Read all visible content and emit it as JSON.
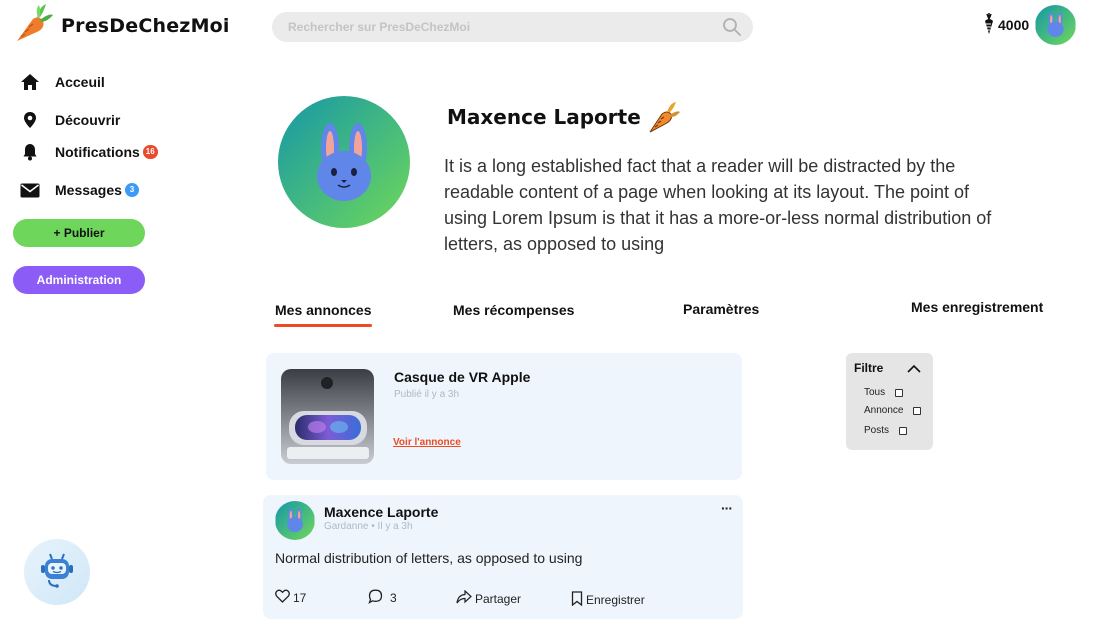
{
  "brand": {
    "name": "PresDeChezMoi",
    "accent": "#ef4b23"
  },
  "search": {
    "placeholder": "Rechercher sur PresDeChezMoi",
    "value": ""
  },
  "header": {
    "coins": "4000"
  },
  "sidebar": {
    "items": [
      {
        "label": "Acceuil",
        "icon": "home-icon"
      },
      {
        "label": "Découvrir",
        "icon": "location-pin-icon"
      },
      {
        "label": "Notifications",
        "icon": "bell-icon",
        "badge": "16"
      },
      {
        "label": "Messages",
        "icon": "envelope-icon",
        "badge": "3"
      }
    ],
    "publish_label": "+ Publier",
    "admin_label": "Administration"
  },
  "profile": {
    "name": "Maxence Laporte",
    "bio": "It is a long established fact that a reader will be distracted by the readable content of a page when looking at its layout. The point of using Lorem Ipsum is that it has a more-or-less normal distribution of letters, as opposed to using"
  },
  "tabs": [
    {
      "label": "Mes annonces",
      "active": true
    },
    {
      "label": "Mes récompenses",
      "active": false
    },
    {
      "label": "Paramètres",
      "active": false
    },
    {
      "label": "Mes enregistrement",
      "active": false
    }
  ],
  "listing": {
    "title": "Casque de VR Apple",
    "meta": "Publié il y a 3h",
    "link": "Voir l'annonce"
  },
  "filter": {
    "title": "Filtre",
    "options": [
      "Tous",
      "Annonce",
      "Posts"
    ]
  },
  "post": {
    "author": "Maxence Laporte",
    "meta": "Gardanne • Il y a 3h",
    "text": "Normal distribution of letters, as opposed to using",
    "likes": "17",
    "comments": "3",
    "share_label": "Partager",
    "save_label": "Enregistrer"
  },
  "colors": {
    "publish": "#6ed65b",
    "admin": "#8b5cf6",
    "card": "#eef5fc",
    "avatar_from": "#1597a8",
    "avatar_to": "#6fd85a"
  }
}
